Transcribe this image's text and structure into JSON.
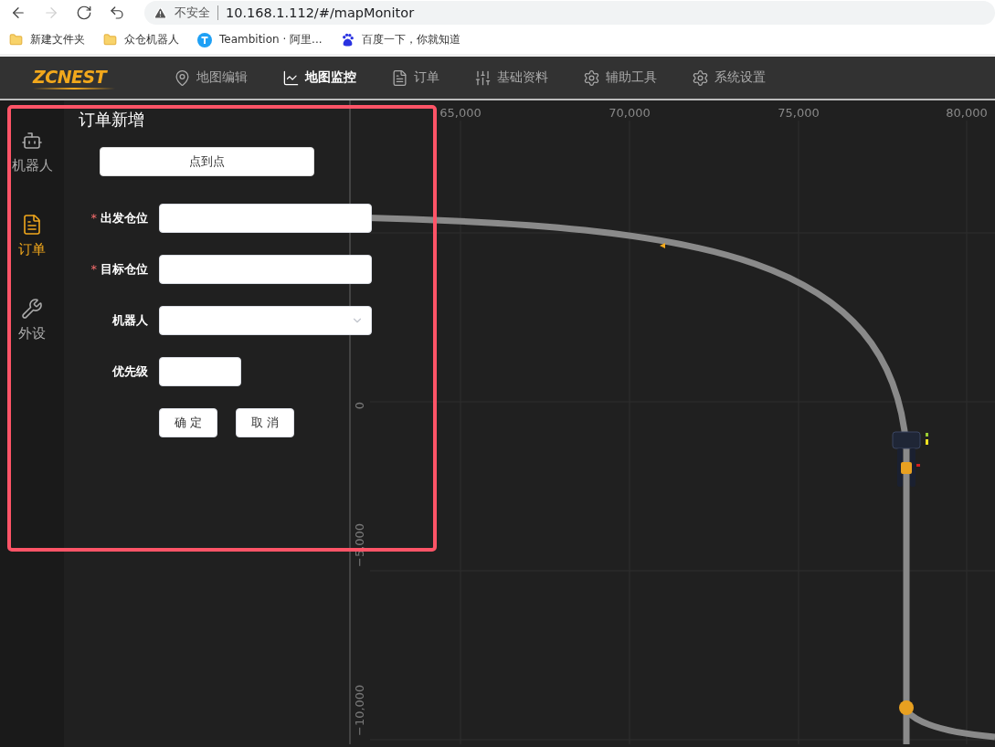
{
  "browser": {
    "nav_buttons": [
      {
        "kind": "back",
        "disabled": false
      },
      {
        "kind": "forward",
        "disabled": true
      },
      {
        "kind": "reload",
        "disabled": false
      },
      {
        "kind": "undo",
        "disabled": false
      }
    ],
    "security_label": "不安全",
    "url": "10.168.1.112/#/mapMonitor",
    "bookmarks": [
      {
        "kind": "folder",
        "label": "新建文件夹"
      },
      {
        "kind": "folder",
        "label": "众仓机器人"
      },
      {
        "kind": "teambition",
        "label": "Teambition · 阿里..."
      },
      {
        "kind": "baidu",
        "label": "百度一下，你就知道"
      }
    ]
  },
  "header": {
    "logo": "ZCNEST",
    "nav": [
      {
        "kind": "pin",
        "label": "地图编辑",
        "selected": false
      },
      {
        "kind": "chart",
        "label": "地图监控",
        "selected": true
      },
      {
        "kind": "file",
        "label": "订单",
        "selected": false
      },
      {
        "kind": "sliders",
        "label": "基础资料",
        "selected": false
      },
      {
        "kind": "gear",
        "label": "辅助工具",
        "selected": false
      },
      {
        "kind": "gear",
        "label": "系统设置",
        "selected": false
      }
    ]
  },
  "sidebar": [
    {
      "kind": "android",
      "label": "机器人",
      "selected": false
    },
    {
      "kind": "file",
      "label": "订单",
      "selected": true
    },
    {
      "kind": "wrench",
      "label": "外设",
      "selected": false
    }
  ],
  "form": {
    "title": "订单新增",
    "mode_button": "点到点",
    "fields": [
      {
        "kind": "text",
        "label": "出发仓位",
        "required_mark": "*"
      },
      {
        "kind": "text",
        "label": "目标仓位",
        "required_mark": "*"
      },
      {
        "kind": "select",
        "label": "机器人"
      },
      {
        "kind": "short",
        "label": "优先级"
      }
    ],
    "buttons": [
      "确 定",
      "取 消"
    ]
  },
  "map": {
    "x_ticks": [
      "65,000",
      "70,000",
      "75,000",
      "80,000"
    ],
    "y_ticks": [
      "0",
      "−5,000",
      "−10,000"
    ]
  }
}
